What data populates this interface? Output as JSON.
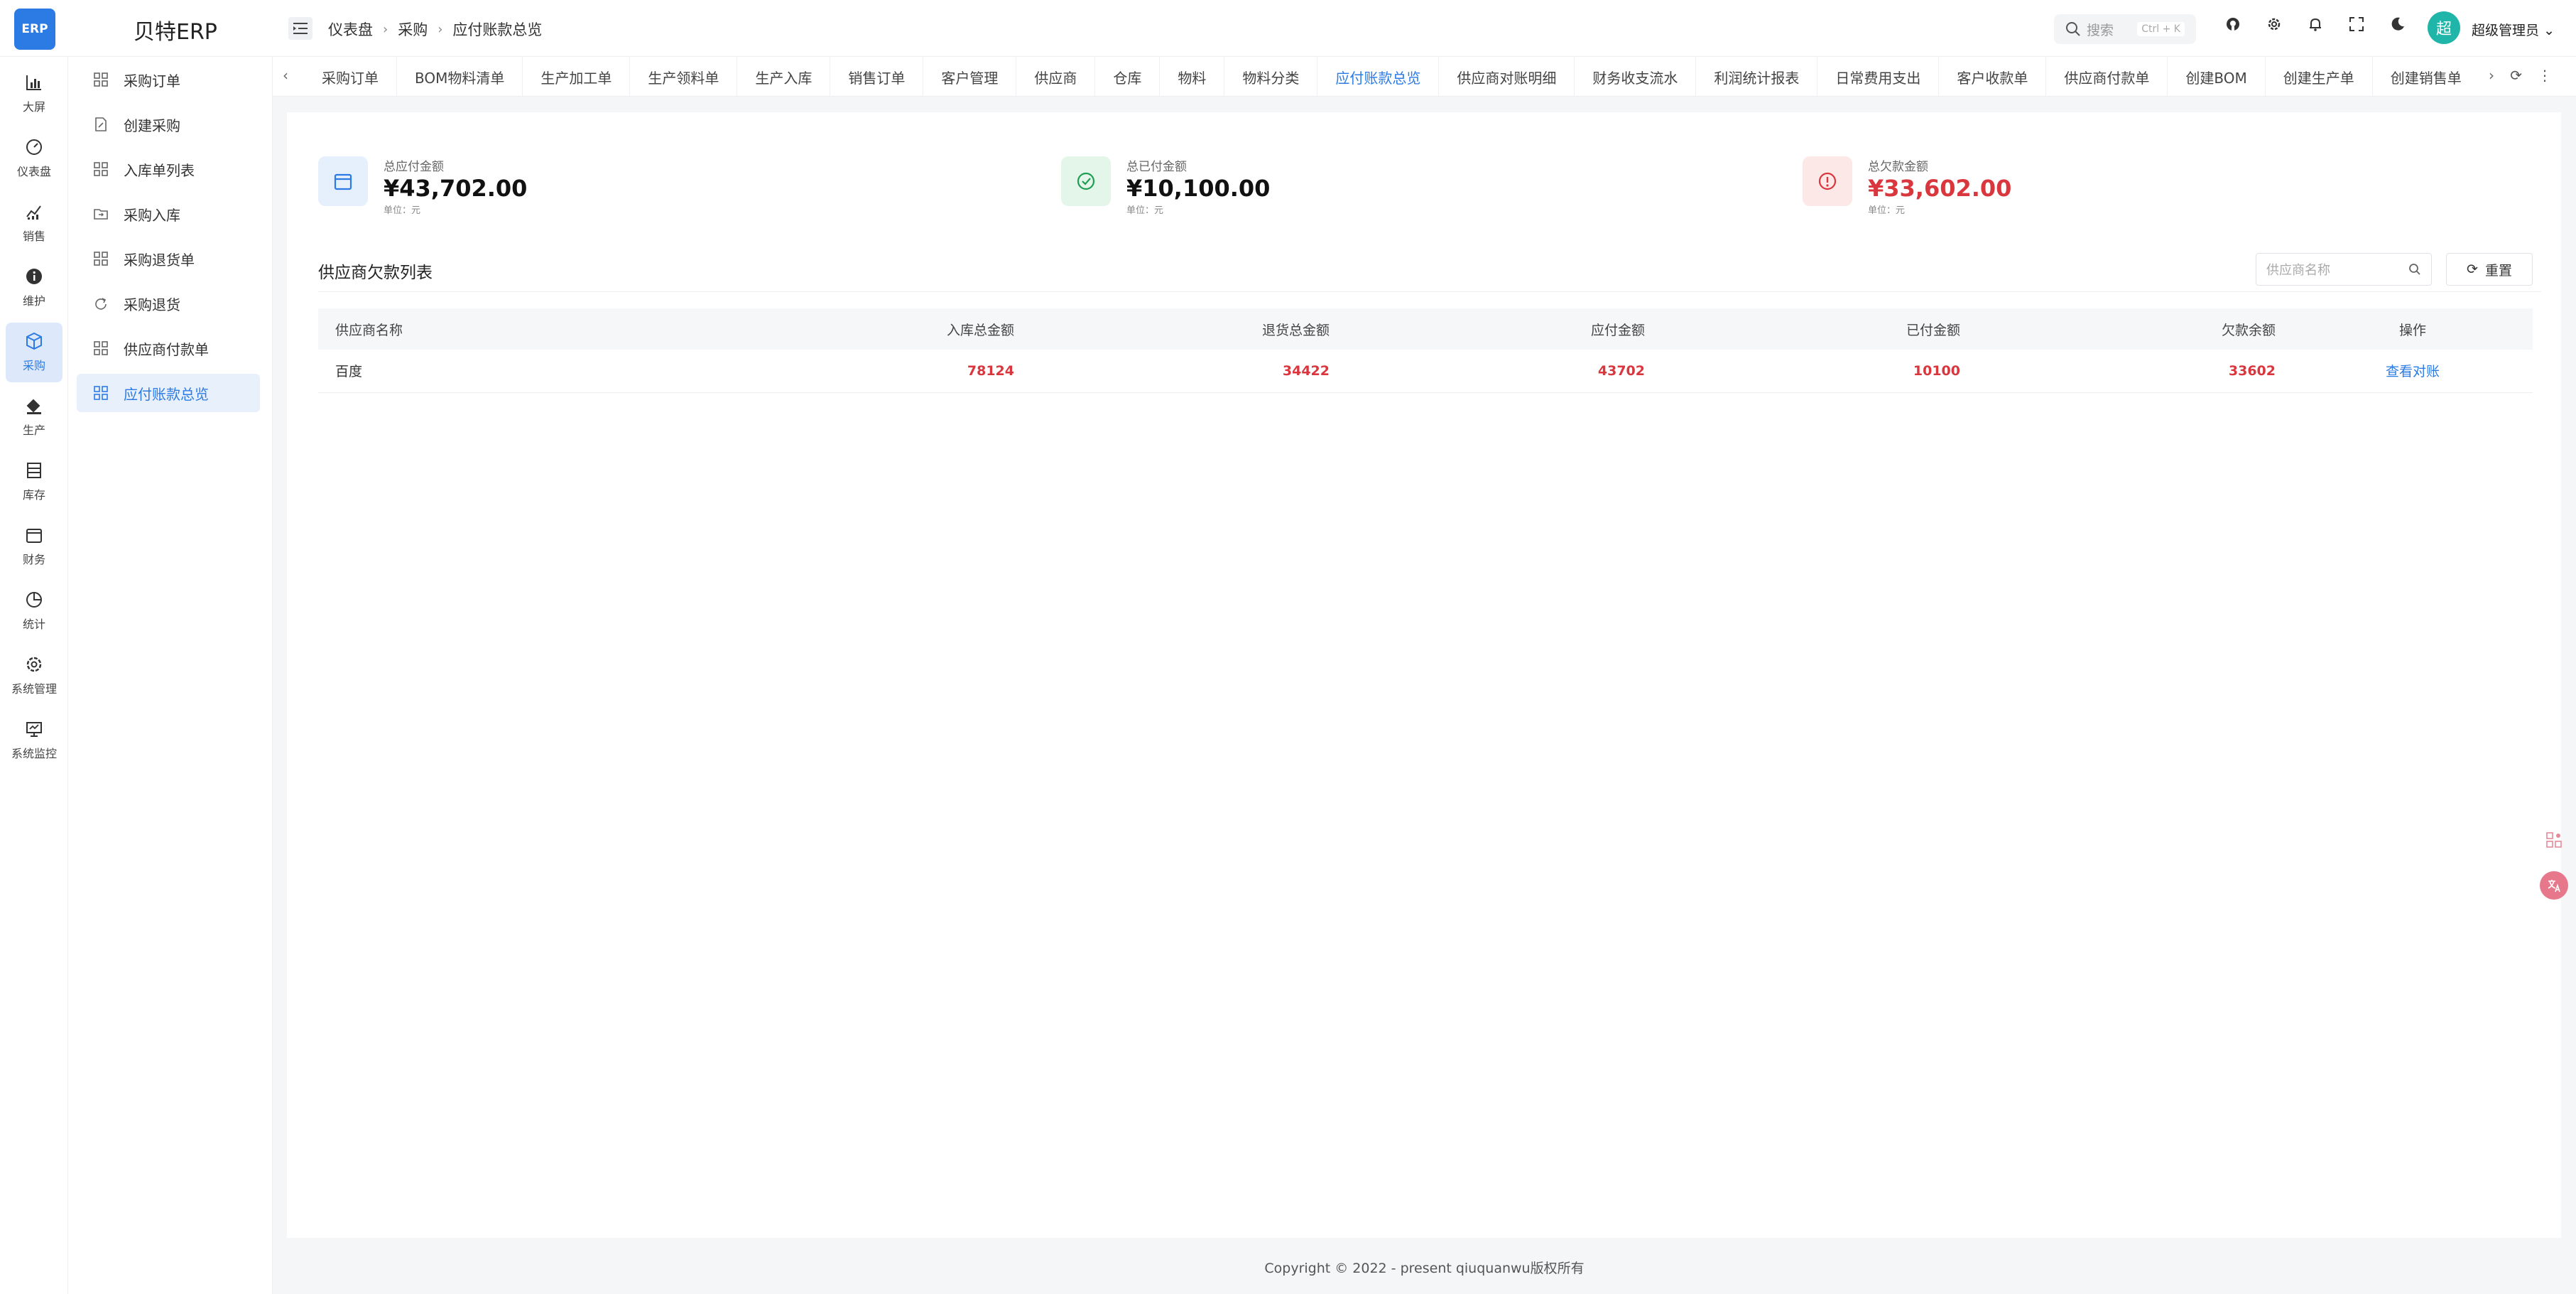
{
  "app": {
    "logo_text": "ERP",
    "title": "贝特ERP"
  },
  "breadcrumb": [
    "仪表盘",
    "采购",
    "应付账款总览"
  ],
  "search": {
    "placeholder": "搜索",
    "shortcut": "Ctrl + K"
  },
  "user": {
    "avatar_char": "超",
    "name": "超级管理员"
  },
  "rail": [
    {
      "label": "大屏",
      "icon": "bar-chart-icon"
    },
    {
      "label": "仪表盘",
      "icon": "dashboard-icon"
    },
    {
      "label": "销售",
      "icon": "sales-chart-icon"
    },
    {
      "label": "维护",
      "icon": "info-icon"
    },
    {
      "label": "采购",
      "icon": "box-icon",
      "active": true
    },
    {
      "label": "生产",
      "icon": "paint-bucket-icon"
    },
    {
      "label": "库存",
      "icon": "warehouse-icon"
    },
    {
      "label": "财务",
      "icon": "calendar-icon"
    },
    {
      "label": "统计",
      "icon": "pie-chart-icon"
    },
    {
      "label": "系统管理",
      "icon": "gear-icon"
    },
    {
      "label": "系统监控",
      "icon": "monitor-icon"
    }
  ],
  "submenu": [
    {
      "label": "采购订单",
      "icon": "grid-icon"
    },
    {
      "label": "创建采购",
      "icon": "edit-doc-icon"
    },
    {
      "label": "入库单列表",
      "icon": "grid-icon"
    },
    {
      "label": "采购入库",
      "icon": "folder-in-icon"
    },
    {
      "label": "采购退货单",
      "icon": "grid-icon"
    },
    {
      "label": "采购退货",
      "icon": "return-icon"
    },
    {
      "label": "供应商付款单",
      "icon": "grid-icon"
    },
    {
      "label": "应付账款总览",
      "icon": "grid-icon",
      "active": true
    }
  ],
  "tabs": [
    "采购订单",
    "BOM物料清单",
    "生产加工单",
    "生产领料单",
    "生产入库",
    "销售订单",
    "客户管理",
    "供应商",
    "仓库",
    "物料",
    "物料分类",
    "应付账款总览",
    "供应商对账明细",
    "财务收支流水",
    "利润统计报表",
    "日常费用支出",
    "客户收款单",
    "供应商付款单",
    "创建BOM",
    "创建生产单",
    "创建销售单"
  ],
  "active_tab": "应付账款总览",
  "stats": [
    {
      "label": "总应付金额",
      "value": "¥43,702.00",
      "unit": "单位：元",
      "color": "#2c7be5",
      "icon": "calendar-icon"
    },
    {
      "label": "总已付金额",
      "value": "¥10,100.00",
      "unit": "单位：元",
      "color": "#1e9e54",
      "icon": "check-circle-icon"
    },
    {
      "label": "总欠款金额",
      "value": "¥33,602.00",
      "unit": "单位：元",
      "color": "#d9363e",
      "icon": "alert-circle-icon"
    }
  ],
  "section": {
    "title": "供应商欠款列表",
    "filter_placeholder": "供应商名称",
    "reset_label": "重置"
  },
  "table": {
    "headers": [
      "供应商名称",
      "入库总金额",
      "退货总金额",
      "应付金额",
      "已付金额",
      "欠款余额",
      "操作"
    ],
    "rows": [
      {
        "name": "百度",
        "inbound": "78124",
        "returns": "34422",
        "payable": "43702",
        "paid": "10100",
        "balance": "33602",
        "action": "查看对账"
      }
    ]
  },
  "footer": "Copyright © 2022 - present qiuquanwu版权所有"
}
